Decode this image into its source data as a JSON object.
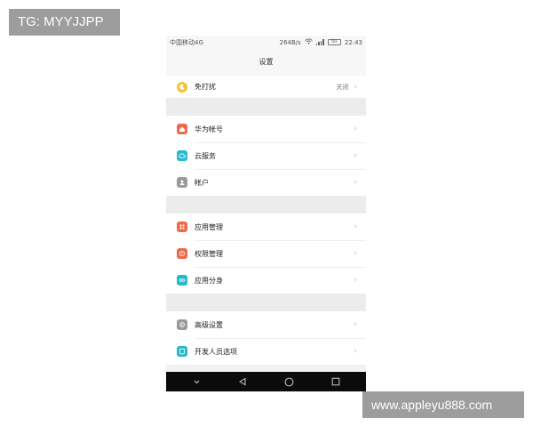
{
  "watermarks": {
    "top_left": "TG: MYYJJPP",
    "bottom_right": "www.appleyu888.com"
  },
  "status_bar": {
    "carrier": "中国移动4G",
    "speed": "264B/s",
    "battery": "50",
    "time": "22:43"
  },
  "title": "设置",
  "groups": [
    {
      "items": [
        {
          "label": "免打扰",
          "value": "关闭",
          "icon": "moon-icon",
          "color": "#f5c22f"
        }
      ]
    },
    {
      "items": [
        {
          "label": "华为帐号",
          "icon": "huawei-account-icon",
          "color": "#ef6a4a"
        },
        {
          "label": "云服务",
          "icon": "cloud-icon",
          "color": "#26b9c9"
        },
        {
          "label": "帐户",
          "icon": "account-icon",
          "color": "#9a9a9a"
        }
      ]
    },
    {
      "items": [
        {
          "label": "应用管理",
          "icon": "app-manage-icon",
          "color": "#ef6a4a"
        },
        {
          "label": "权限管理",
          "icon": "permission-icon",
          "color": "#ef6a4a"
        },
        {
          "label": "应用分身",
          "icon": "app-twin-icon",
          "color": "#26b9c9"
        }
      ]
    },
    {
      "items": [
        {
          "label": "高级设置",
          "icon": "gear-icon",
          "color": "#9a9a9a"
        },
        {
          "label": "开发人员选项",
          "icon": "developer-icon",
          "color": "#26b9c9"
        }
      ]
    }
  ]
}
